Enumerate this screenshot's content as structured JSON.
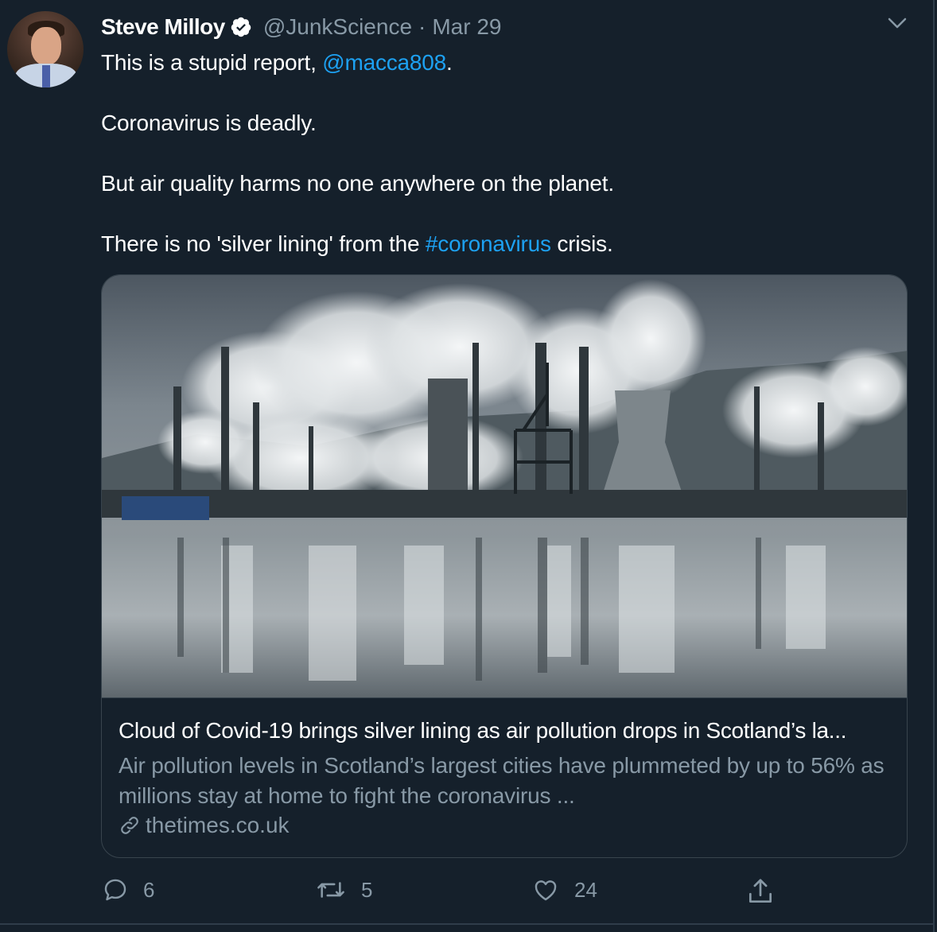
{
  "author": {
    "name": "Steve Milloy",
    "handle": "@JunkScience",
    "separator": "·",
    "date": "Mar 29"
  },
  "tweet": {
    "line1_prefix": "This is a stupid report, ",
    "line1_mention": "@macca808",
    "line1_suffix": ".",
    "line2": "Coronavirus is deadly.",
    "line3": "But air quality harms no one anywhere on the planet.",
    "line4_prefix": "There is no 'silver lining' from the ",
    "line4_hashtag": "#coronavirus",
    "line4_suffix": " crisis."
  },
  "card": {
    "title": "Cloud of Covid-19 brings silver lining as air pollution drops in Scotland’s la...",
    "description": "Air pollution levels in Scotland’s largest cities have plummeted by up to 56% as millions stay at home to fight the coronavirus ...",
    "source": "thetimes.co.uk"
  },
  "actions": {
    "replies": "6",
    "retweets": "5",
    "likes": "24"
  },
  "colors": {
    "background": "#15202b",
    "link": "#1da1f2",
    "muted": "#8899a6",
    "border": "#38444d"
  }
}
